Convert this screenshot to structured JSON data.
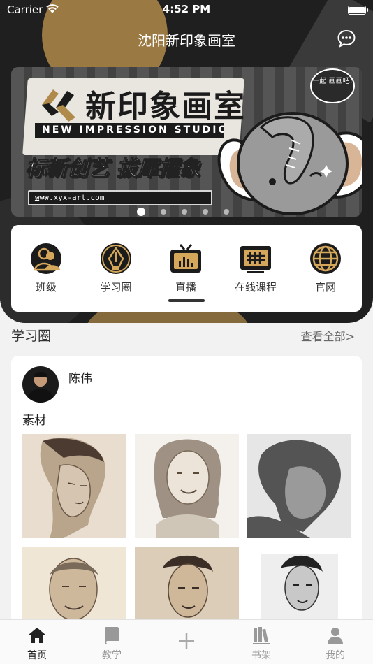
{
  "status_bar": {
    "carrier": "Carrier",
    "time": "4:52 PM"
  },
  "nav": {
    "title": "沈阳新印象画室"
  },
  "banner": {
    "brand_cn": "新印象画室",
    "brand_en": "NEW IMPRESSION STUDIO",
    "slogan": "标新创艺 拔犀擢象",
    "url": "www.xyx-art.com",
    "bubble_text": "一起 画画吧!",
    "page_count": 5,
    "active_page": 1
  },
  "menu": {
    "items": [
      {
        "label": "班级",
        "icon": "users-icon"
      },
      {
        "label": "学习圈",
        "icon": "pen-nib-icon"
      },
      {
        "label": "直播",
        "icon": "tv-icon"
      },
      {
        "label": "在线课程",
        "icon": "online-course-icon"
      },
      {
        "label": "官网",
        "icon": "globe-icon"
      }
    ]
  },
  "section": {
    "title": "学习圈",
    "more": "查看全部>"
  },
  "post": {
    "author": "陈伟",
    "caption": "素材",
    "images": [
      "portrait-woman-profile",
      "portrait-girl-smiling",
      "portrait-charcoal-man",
      "portrait-old-man",
      "portrait-young-man",
      "portrait-man-bw"
    ]
  },
  "tabbar": {
    "tabs": [
      {
        "label": "首页",
        "icon": "home-icon",
        "active": true
      },
      {
        "label": "教学",
        "icon": "book-icon",
        "active": false
      },
      {
        "label": "",
        "icon": "plus-icon",
        "active": false
      },
      {
        "label": "书架",
        "icon": "bookshelf-icon",
        "active": false
      },
      {
        "label": "我的",
        "icon": "person-icon",
        "active": false
      }
    ]
  },
  "colors": {
    "accent_gold": "#b08a4a",
    "dark_bg": "#1f1f1f"
  }
}
